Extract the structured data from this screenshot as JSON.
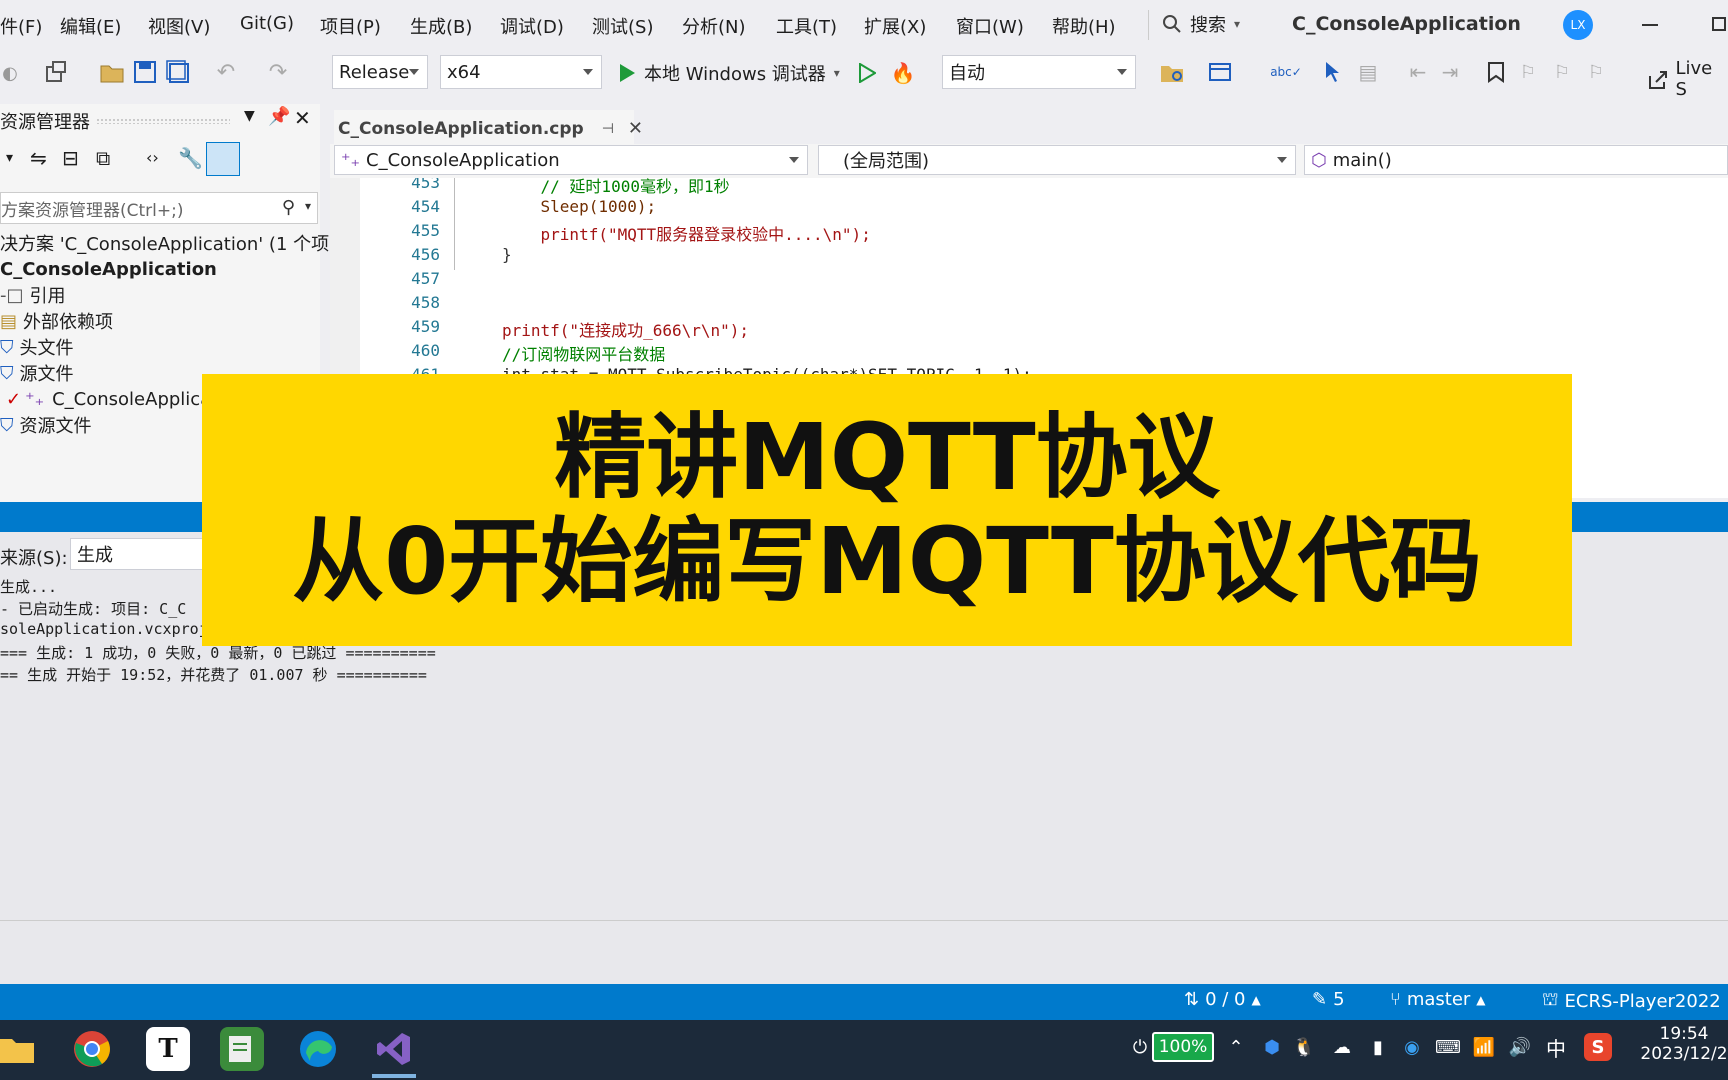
{
  "menu": [
    "件(F)",
    "编辑(E)",
    "视图(V)",
    "Git(G)",
    "项目(P)",
    "生成(B)",
    "调试(D)",
    "测试(S)",
    "分析(N)",
    "工具(T)",
    "扩展(X)",
    "窗口(W)",
    "帮助(H)"
  ],
  "search_label": "搜索",
  "window_title": "C_ConsoleApplication",
  "avatar_initials": "LX",
  "toolbar": {
    "config": "Release",
    "platform": "x64",
    "debugger": "本地 Windows 调试器",
    "auto": "自动",
    "live_share": "Live S"
  },
  "solution_explorer": {
    "title": "资源管理器",
    "search_placeholder": "方案资源管理器(Ctrl+;)",
    "rows": [
      "决方案 'C_ConsoleApplication' (1 个项目",
      "C_ConsoleApplication",
      "引用",
      "外部依赖项",
      "头文件",
      "源文件",
      "C_ConsoleApplica",
      "资源文件"
    ]
  },
  "editor": {
    "tab": "C_ConsoleApplication.cpp",
    "nav_project": "C_ConsoleApplication",
    "nav_scope": "(全局范围)",
    "nav_member": "main()",
    "line_numbers": [
      "453",
      "454",
      "455",
      "456",
      "457",
      "458",
      "459",
      "460",
      "461"
    ],
    "lines": [
      "    // 延时1000毫秒，即1秒",
      "    Sleep(1000);",
      "    printf(\"MQTT服务器登录校验中....\\n\");",
      "}",
      "",
      "",
      "printf(\"连接成功_666\\r\\n\");",
      "//订阅物联网平台数据",
      "int stat = MQTT_SubscribeTopic((char*)SET_TOPIC, 1, 1);"
    ]
  },
  "output": {
    "source_label": "来源(S):",
    "source_value": "生成",
    "lines": [
      "生成...",
      "- 已启动生成: 项目: C_C",
      "soleApplication.vcxproj",
      "=== 生成: 1 成功，0 失败，0 最新，0 已跳过 ==========",
      "== 生成 开始于 19:52，并花费了 01.007 秒 =========="
    ]
  },
  "banner": {
    "line1": "精讲MQTT协议",
    "line2": "从0开始编写MQTT协议代码",
    "color": "#ffd700"
  },
  "status_bar": {
    "changes": "0 / 0",
    "pencil_count": "5",
    "branch": "master",
    "repo": "ECRS-Player2022"
  },
  "taskbar": {
    "battery": "100%",
    "ime": "中",
    "time": "19:54",
    "date": "2023/12/2"
  },
  "colors": {
    "accent": "#007acc",
    "status_bar": "#007acc",
    "taskbar": "#1c2a3a"
  }
}
